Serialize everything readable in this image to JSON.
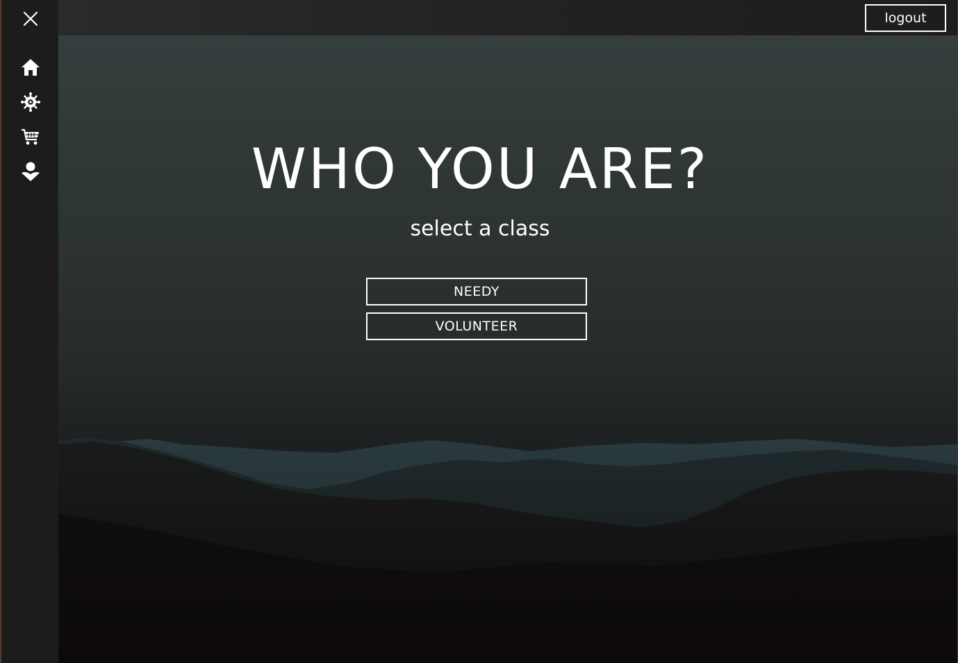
{
  "header": {
    "logout_label": "logout"
  },
  "sidebar": {
    "items": [
      {
        "icon": "close-icon"
      },
      {
        "icon": "home-icon"
      },
      {
        "icon": "virus-icon"
      },
      {
        "icon": "cart-icon"
      },
      {
        "icon": "donate-icon"
      }
    ]
  },
  "main": {
    "title": "WHO YOU ARE?",
    "subtitle": "select a class",
    "options": [
      {
        "label": "NEEDY"
      },
      {
        "label": "VOLUNTEER"
      }
    ]
  },
  "colors": {
    "text": "#ffffff",
    "sidebar_bg": "#1c1c1c",
    "accent_edge": "#5a3a2c"
  }
}
